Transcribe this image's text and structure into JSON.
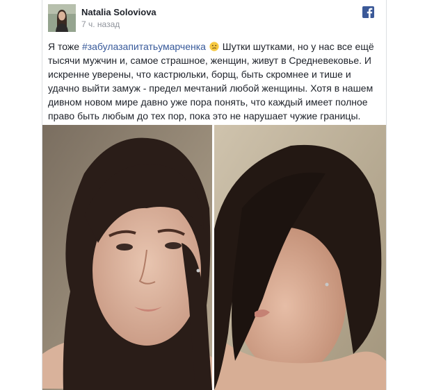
{
  "post": {
    "author": {
      "name": "Natalia Soloviova",
      "timestamp": "7 ч. назад"
    },
    "text": {
      "prefix": "Я тоже ",
      "hashtag": "#забулазапитатьумарченка",
      "emoji": "confused-face",
      "body": " Шутки шутками, но у нас все ещё тысячи мужчин и, самое страшное, женщин, живут в Средневековье. И искренне уверены, что кастрюльки, борщ, быть скромнее и тише и удачно выйти замуж - предел мечтаний любой женщины. Хотя в нашем дивном новом мире давно уже пора понять, что каждый имеет полное право быть любым до тех пор, пока это не нарушает чужие границы."
    },
    "source_icon": "facebook-icon",
    "photos": [
      "face-photo-front",
      "face-photo-profile"
    ]
  },
  "colors": {
    "name": "#1d2129",
    "timestamp": "#90949c",
    "hashtag": "#365899",
    "facebook": "#3b5998"
  }
}
